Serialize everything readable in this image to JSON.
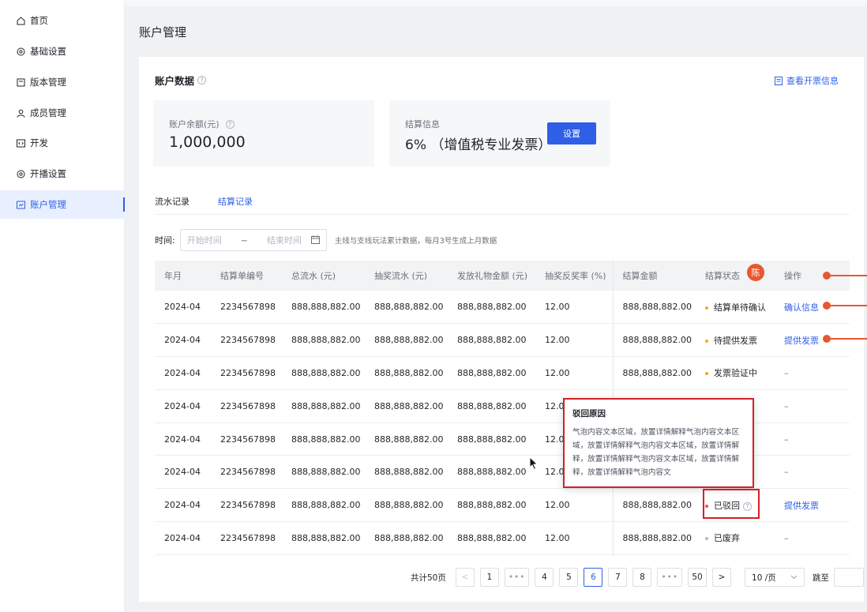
{
  "sidebar": {
    "items": [
      {
        "label": "首页",
        "icon": "home-icon"
      },
      {
        "label": "基础设置",
        "icon": "settings-icon"
      },
      {
        "label": "版本管理",
        "icon": "version-icon"
      },
      {
        "label": "成员管理",
        "icon": "user-icon"
      },
      {
        "label": "开发",
        "icon": "code-icon"
      },
      {
        "label": "开播设置",
        "icon": "broadcast-settings-icon"
      },
      {
        "label": "账户管理",
        "icon": "account-icon",
        "active": true
      }
    ]
  },
  "page": {
    "title": "账户管理"
  },
  "account": {
    "section_title": "账户数据",
    "invoice_link": "查看开票信息",
    "balance_label": "账户余额(元)",
    "balance_value": "1,000,000",
    "settle_label": "结算信息",
    "settle_value": "6% （增值税专业发票）",
    "settle_button": "设置"
  },
  "tabs": [
    "流水记录",
    "结算记录"
  ],
  "active_tab": 1,
  "filter": {
    "label": "时间:",
    "start_placeholder": "开始时间",
    "separator": "~",
    "end_placeholder": "结束时间",
    "hint": "主线与支线玩法累计数据，每月3号生成上月数据"
  },
  "table": {
    "headers": [
      "年月",
      "结算单编号",
      "总流水 (元)",
      "抽奖流水 (元)",
      "发放礼物金额 (元)",
      "抽奖反奖率 (%)",
      "结算金额",
      "结算状态",
      "操作"
    ],
    "rows": [
      {
        "month": "2024-04",
        "id": "2234567898",
        "total": "888,888,882.00",
        "lottery": "888,888,882.00",
        "gift": "888,888,882.00",
        "rate": "12.00",
        "amount": "888,888,882.00",
        "status": "结算单待确认",
        "status_color": "#f5a623",
        "action": "确认信息"
      },
      {
        "month": "2024-04",
        "id": "2234567898",
        "total": "888,888,882.00",
        "lottery": "888,888,882.00",
        "gift": "888,888,882.00",
        "rate": "12.00",
        "amount": "888,888,882.00",
        "status": "待提供发票",
        "status_color": "#f5a623",
        "action": "提供发票"
      },
      {
        "month": "2024-04",
        "id": "2234567898",
        "total": "888,888,882.00",
        "lottery": "888,888,882.00",
        "gift": "888,888,882.00",
        "rate": "12.00",
        "amount": "888,888,882.00",
        "status": "发票验证中",
        "status_color": "#f5a623",
        "action": "–"
      },
      {
        "month": "2024-04",
        "id": "2234567898",
        "total": "888,888,882.00",
        "lottery": "888,888,882.00",
        "gift": "888,888,882.00",
        "rate": "12.00",
        "amount": "",
        "status": "",
        "status_color": "",
        "action": "–"
      },
      {
        "month": "2024-04",
        "id": "2234567898",
        "total": "888,888,882.00",
        "lottery": "888,888,882.00",
        "gift": "888,888,882.00",
        "rate": "12.00",
        "amount": "",
        "status": "",
        "status_color": "",
        "action": "–"
      },
      {
        "month": "2024-04",
        "id": "2234567898",
        "total": "888,888,882.00",
        "lottery": "888,888,882.00",
        "gift": "888,888,882.00",
        "rate": "12.00",
        "amount": "",
        "status": "",
        "status_color": "",
        "action": "–"
      },
      {
        "month": "2024-04",
        "id": "2234567898",
        "total": "888,888,882.00",
        "lottery": "888,888,882.00",
        "gift": "888,888,882.00",
        "rate": "12.00",
        "amount": "888,888,882.00",
        "status": "已驳回",
        "status_color": "#e8572f",
        "action": "提供发票"
      },
      {
        "month": "2024-04",
        "id": "2234567898",
        "total": "888,888,882.00",
        "lottery": "888,888,882.00",
        "gift": "888,888,882.00",
        "rate": "12.00",
        "amount": "888,888,882.00",
        "status": "已废弃",
        "status_color": "#b3b8c1",
        "action": "–"
      }
    ]
  },
  "tooltip": {
    "title": "驳回原因",
    "body": "气泡内容文本区域，放置详情解释气泡内容文本区域，放置详情解释气泡内容文本区域，放置详情解释，放置详情解释气泡内容文本区域，放置详情解释，放置详情解释气泡内容文"
  },
  "avatar": {
    "text": "陈"
  },
  "pagination": {
    "total": "共计50页",
    "prev": "<",
    "pages": [
      "1",
      "•••",
      "4",
      "5",
      "6",
      "7",
      "8",
      "•••",
      "50"
    ],
    "active_page": "6",
    "next": ">",
    "page_size": "10 /页",
    "jump_label": "跳至"
  },
  "colors": {
    "accent": "#2f5fe7",
    "annotation": "#e8572f",
    "highlight_box": "#d32029"
  }
}
